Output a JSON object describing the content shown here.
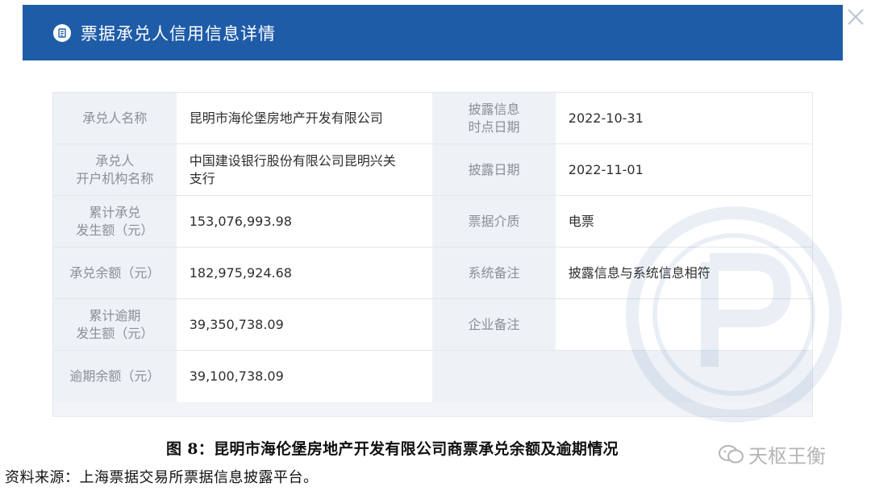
{
  "header": {
    "title": "票据承兑人信用信息详情",
    "icon": "document-list-icon",
    "close_icon": "close-icon",
    "background_color": "#1f5ca8"
  },
  "details": {
    "rows": [
      {
        "left_label": "承兑人名称",
        "left_value": "昆明市海伦堡房地产开发有限公司",
        "right_label": "披露信息\n时点日期",
        "right_value": "2022-10-31"
      },
      {
        "left_label": "承兑人\n开户机构名称",
        "left_value": "中国建设银行股份有限公司昆明兴关\n支行",
        "right_label": "披露日期",
        "right_value": "2022-11-01"
      },
      {
        "left_label": "累计承兑\n发生额（元）",
        "left_value": "153,076,993.98",
        "right_label": "票据介质",
        "right_value": "电票"
      },
      {
        "left_label": "承兑余额（元）",
        "left_value": "182,975,924.68",
        "right_label": "系统备注",
        "right_value": "披露信息与系统信息相符"
      },
      {
        "left_label": "累计逾期\n发生额（元）",
        "left_value": "39,350,738.09",
        "right_label": "企业备注",
        "right_value": ""
      },
      {
        "left_label": "逾期余额（元）",
        "left_value": "39,100,738.09",
        "right_label": "",
        "right_value": ""
      }
    ]
  },
  "caption": "图 8：昆明市海伦堡房地产开发有限公司商票承兑余额及逾期情况",
  "brand": {
    "text": "天枢王衡",
    "icon": "wechat-icon"
  },
  "source": "资料来源：上海票据交易所票据信息披露平台。"
}
